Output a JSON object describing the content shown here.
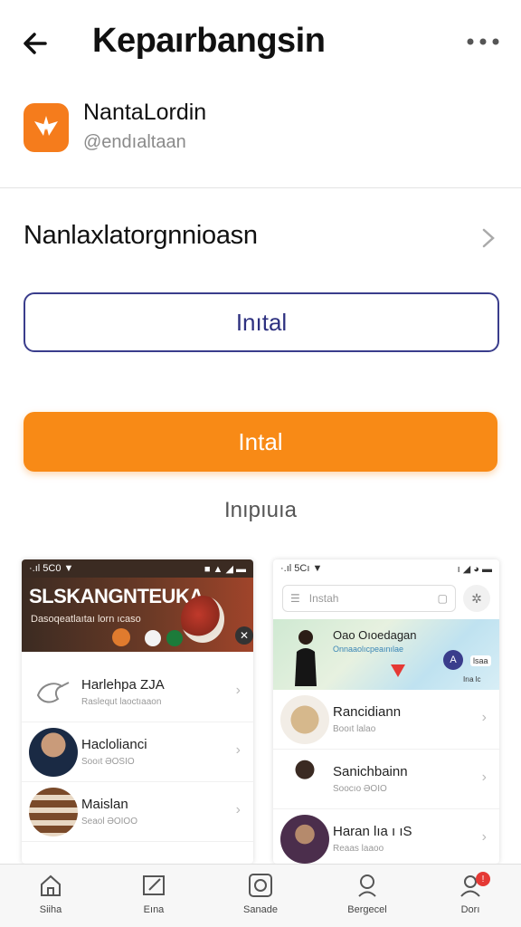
{
  "header": {
    "title": "Kepaırbangsin"
  },
  "app": {
    "name": "NantaLordin",
    "handle": "@endıaltaan"
  },
  "section": {
    "title": "Nanlaxlatorgnnioasn"
  },
  "buttons": {
    "outline_label": "Inıtal",
    "primary_label": "Intal",
    "link_text": "Inıpıuıa"
  },
  "preview_left": {
    "status_left": "·.ıl 5C0 ▼",
    "status_right": "■ ▲ ◢ ▬",
    "hero_title": "SLSKANGNTEUKA",
    "hero_sub": "Dasoqeatlaıtaı lorn ıcaso",
    "items": [
      {
        "name": "Harlehpa ZJA",
        "sub": "Raslequt laoctıaaon"
      },
      {
        "name": "Haclolianci",
        "sub": "Sooıt ƏOSIO"
      },
      {
        "name": "Maislan",
        "sub": "Seaol ƏOIOO"
      }
    ]
  },
  "preview_right": {
    "status_left": "·.ıl 5Cı ▼",
    "status_right": "ı ◢ ◕ ▬",
    "search_placeholder": "Instah",
    "map_title": "Oao Oıoedagan",
    "map_sub": "Onnaaolıcpeaınılae",
    "map_badge": "A",
    "map_tag": "lsaa",
    "map_foot": "Irıa lc",
    "items": [
      {
        "name": "Rancidiann",
        "sub": "Booıt lalao"
      },
      {
        "name": "Sanichbainn",
        "sub": "Soocıo ƏOIO"
      },
      {
        "name": "Haran lıa ı ıS",
        "sub": "Reaas laaoo"
      }
    ]
  },
  "nav": [
    {
      "label": "Siiha",
      "icon": "home-icon"
    },
    {
      "label": "Eına",
      "icon": "edit-icon"
    },
    {
      "label": "Sanade",
      "icon": "camera-icon"
    },
    {
      "label": "Bergecel",
      "icon": "location-person-icon"
    },
    {
      "label": "Dorı",
      "icon": "profile-icon",
      "badge": "!"
    }
  ],
  "colors": {
    "accent": "#f88a16",
    "primary_outline": "#3a3d8c",
    "app_icon": "#f57c1c"
  }
}
